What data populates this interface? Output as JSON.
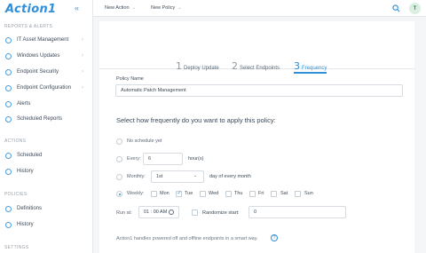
{
  "brand": {
    "name": "Action1",
    "collapse_icon": "«"
  },
  "sidebar": {
    "section_reports": "REPORTS & ALERTS",
    "reports_items": [
      {
        "label": "IT Asset Management",
        "chevron": "›"
      },
      {
        "label": "Windows Updates",
        "chevron": "›"
      },
      {
        "label": "Endpoint Security",
        "chevron": "›"
      },
      {
        "label": "Endpoint Configuration",
        "chevron": "›"
      },
      {
        "label": "Alerts"
      },
      {
        "label": "Scheduled Reports"
      }
    ],
    "section_actions": "ACTIONS",
    "actions_items": [
      {
        "label": "Scheduled"
      },
      {
        "label": "History"
      }
    ],
    "section_policies": "POLICIES",
    "policies_items": [
      {
        "label": "Definitions"
      },
      {
        "label": "History"
      }
    ],
    "section_settings": "SETTINGS"
  },
  "topbar": {
    "new_action": "New Action",
    "new_policy": "New Policy",
    "dropdown_icon": "⌄",
    "avatar_initial": "T"
  },
  "steps": [
    {
      "num": "1",
      "label": "Deploy Update"
    },
    {
      "num": "2",
      "label": "Select Endpoints"
    },
    {
      "num": "3",
      "label": "Frequency"
    }
  ],
  "form": {
    "policy_name_label": "Policy Name",
    "policy_name_value": "Automatic Patch Management",
    "question": "Select how frequently do you want to apply this policy:",
    "opt_no_schedule": "No schedule yet",
    "opt_every": "Every:",
    "every_value": "6",
    "every_unit": "hour(s)",
    "opt_monthly": "Monthly:",
    "monthly_value": "1st",
    "monthly_suffix": "day of every month",
    "opt_weekly": "Weekly:",
    "days": [
      {
        "label": "Mon",
        "checked": false
      },
      {
        "label": "Tue",
        "checked": true
      },
      {
        "label": "Wed",
        "checked": false
      },
      {
        "label": "Thu",
        "checked": false
      },
      {
        "label": "Fri",
        "checked": false
      },
      {
        "label": "Sat",
        "checked": false
      },
      {
        "label": "Sun",
        "checked": false
      }
    ],
    "run_at_label": "Run at:",
    "run_at_value": "01 : 00  AM",
    "randomize_label": "Randomize start:",
    "randomize_value": "0",
    "footer": "Action1 handles powered off and offline endpoints in a smart way.",
    "help": "?"
  },
  "colors": {
    "accent": "#2f8fd8",
    "bg": "#f4f6f8",
    "text": "#3d4a59"
  }
}
